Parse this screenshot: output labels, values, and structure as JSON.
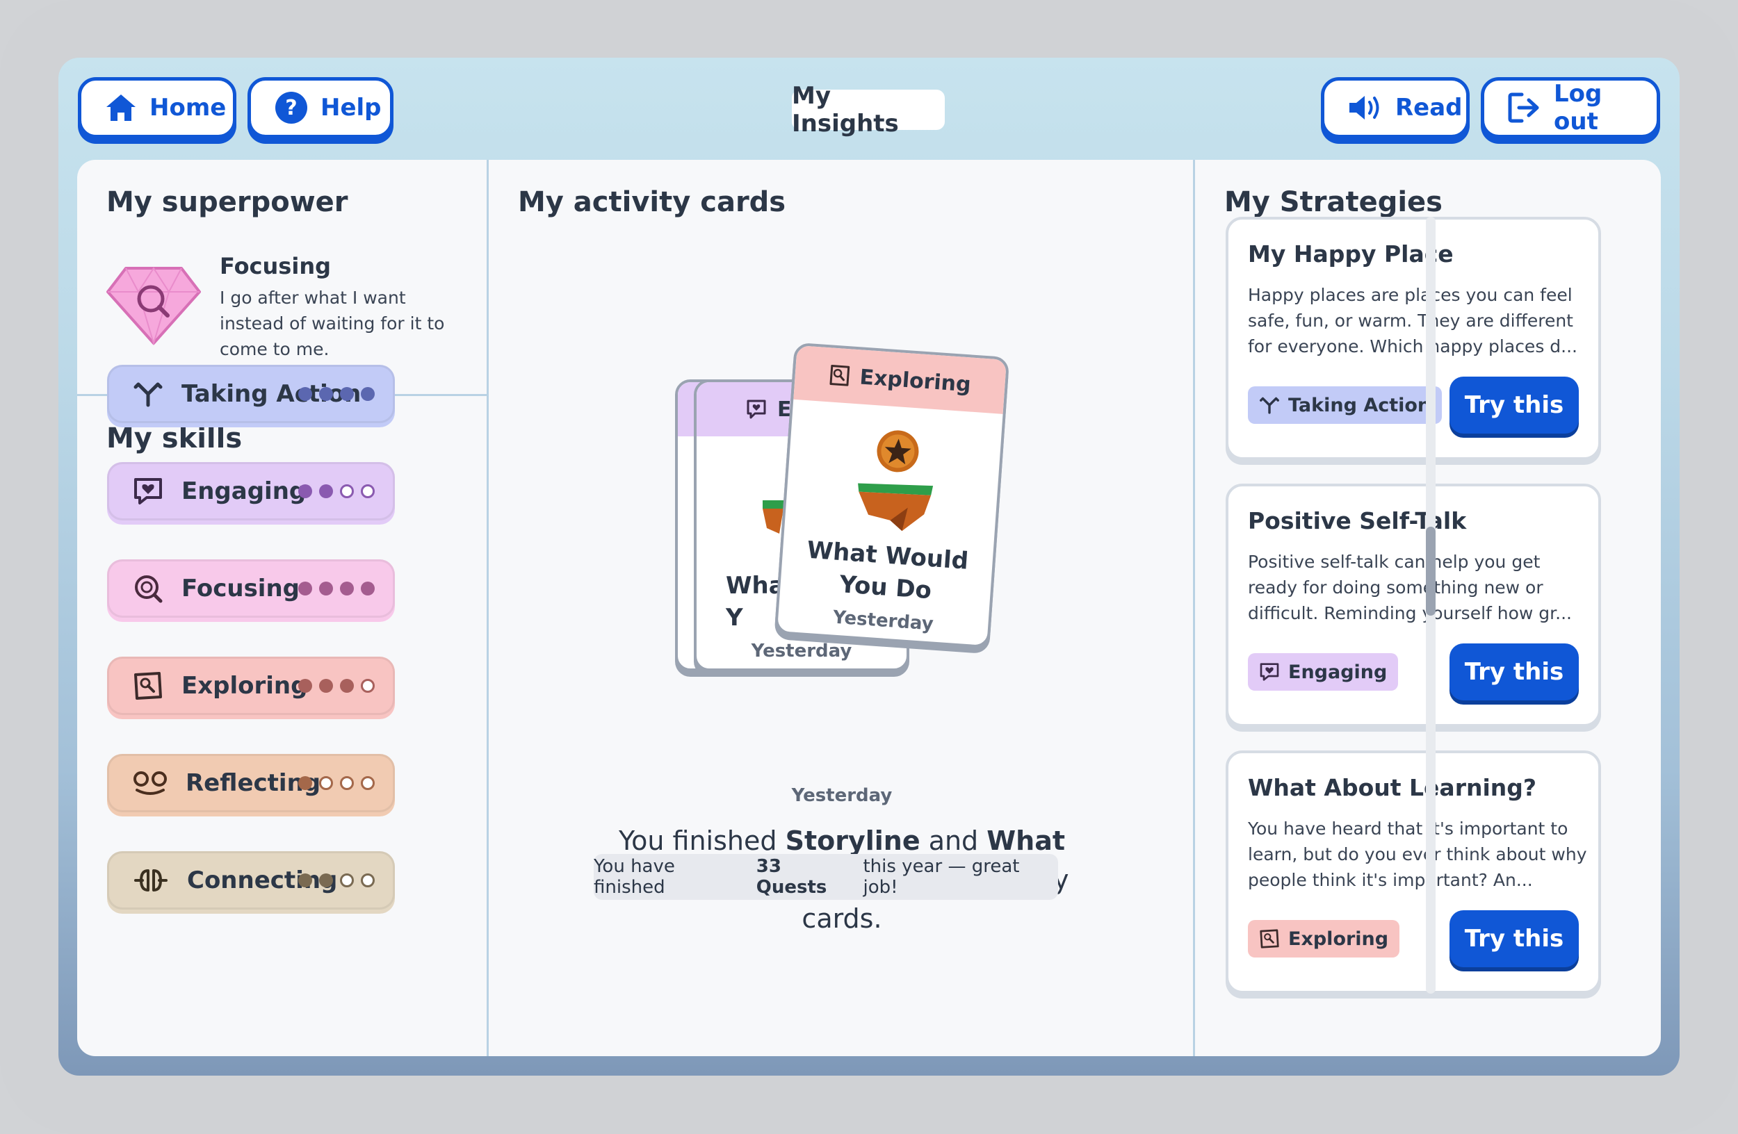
{
  "header": {
    "home_label": "Home",
    "help_label": "Help",
    "title": "My Insights",
    "read_label": "Read",
    "logout_label": "Log out"
  },
  "superpower": {
    "section_title": "My superpower",
    "name": "Focusing",
    "description": "I go after what I want instead of waiting for it to come to me."
  },
  "skills": {
    "section_title": "My skills",
    "items": [
      {
        "label": "Taking Action",
        "level": 4,
        "max": 4,
        "color": "#c2cbf7",
        "dot": "#5b67b0"
      },
      {
        "label": "Engaging",
        "level": 2,
        "max": 4,
        "color": "#e2cbf7",
        "dot": "#8a5ab0"
      },
      {
        "label": "Focusing",
        "level": 4,
        "max": 4,
        "color": "#f8c9ea",
        "dot": "#a45c8f"
      },
      {
        "label": "Exploring",
        "level": 3,
        "max": 4,
        "color": "#f8c4c2",
        "dot": "#a8605c"
      },
      {
        "label": "Reflecting",
        "level": 1,
        "max": 4,
        "color": "#f1cbb2",
        "dot": "#a4684a"
      },
      {
        "label": "Connecting",
        "level": 2,
        "max": 4,
        "color": "#e3d7c2",
        "dot": "#7a6a52"
      }
    ]
  },
  "activity": {
    "section_title": "My activity cards",
    "back_card_band_letter": "E",
    "back_card_title": "Wha\nY",
    "back_card_date": "Yesterday",
    "front_card_band": "Exploring",
    "front_card_title": "What Would You Do",
    "front_card_date": "Yesterday",
    "date": "Yesterday",
    "message_prefix": "You finished ",
    "message_game1": "Storyline",
    "message_and": " and ",
    "message_game2": "What Would You Do",
    "message_suffix": " and earned 3 play cards.",
    "quests_prefix": "You have finished ",
    "quests_count": "33 Quests",
    "quests_suffix": " this year — great job!"
  },
  "strategies": {
    "section_title": "My Strategies",
    "items": [
      {
        "title": "My Happy Place",
        "description": "Happy places are places you can feel safe, fun, or warm. They are different for everyone. Which happy places d...",
        "tag": "Taking Action",
        "tag_color": "#c2cbf7",
        "button": "Try this"
      },
      {
        "title": "Positive Self-Talk",
        "description": "Positive self-talk can help you get ready for doing something new or difficult. Reminding yourself how gr...",
        "tag": "Engaging",
        "tag_color": "#e2cbf7",
        "button": "Try this"
      },
      {
        "title": "What About Learning?",
        "description": "You have heard that it's important to learn, but do you ever think about why people think it's important?  An...",
        "tag": "Exploring",
        "tag_color": "#f8c4c2",
        "button": "Try this"
      }
    ],
    "scroll_position": 0.45
  }
}
